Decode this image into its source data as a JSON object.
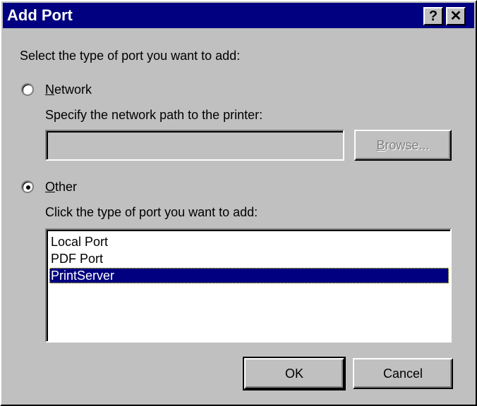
{
  "window": {
    "title": "Add Port",
    "help_label": "?",
    "close_label": "✕"
  },
  "prompt": "Select the type of port you want to add:",
  "network": {
    "label_prefix": "",
    "label_mnemonic": "N",
    "label_rest": "etwork",
    "selected": false,
    "path_label": "Specify the network path to the printer:",
    "path_value": "",
    "browse_mnemonic": "B",
    "browse_rest": "rowse...",
    "browse_enabled": false
  },
  "other": {
    "label_mnemonic": "O",
    "label_rest": "ther",
    "selected": true,
    "list_label": "Click the type of port you want to add:",
    "ports": [
      "Local Port",
      "PDF Port",
      "PrintServer"
    ],
    "selected_port": "PrintServer"
  },
  "buttons": {
    "ok": "OK",
    "cancel": "Cancel"
  },
  "colors": {
    "title_bar": "#000080",
    "face": "#c0c0c0",
    "selection": "#000080"
  }
}
